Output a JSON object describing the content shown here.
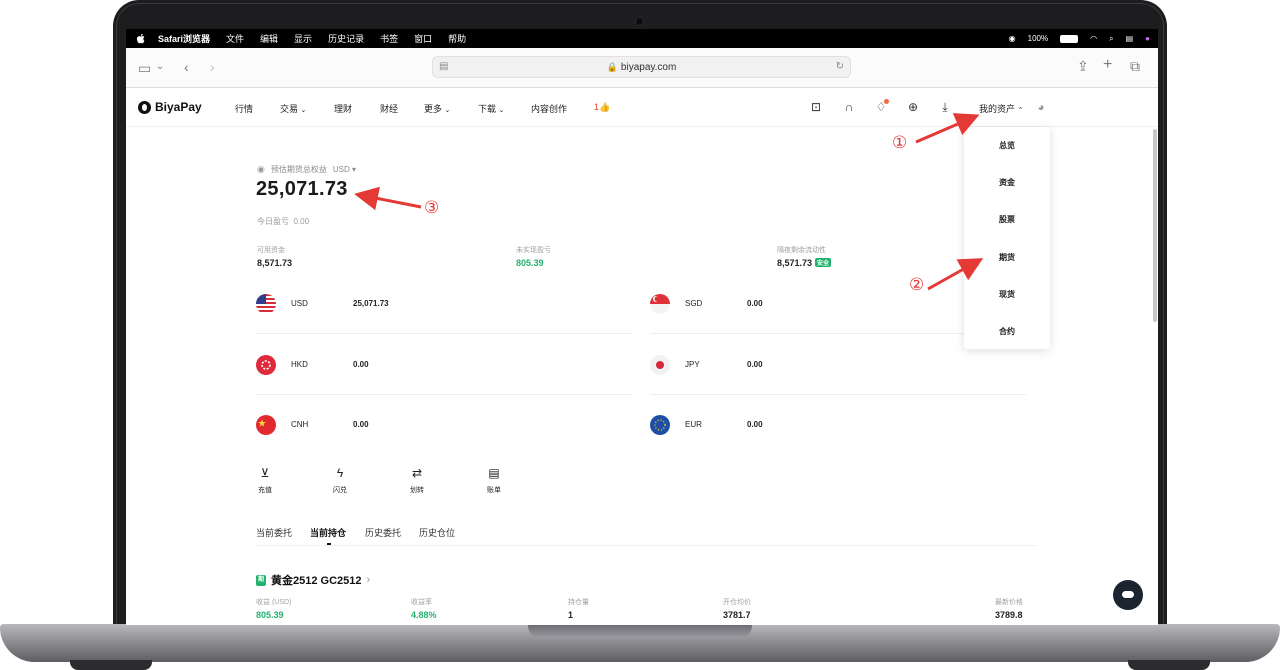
{
  "menubar": {
    "app_name": "Safari浏览器",
    "items": [
      "文件",
      "编辑",
      "显示",
      "历史记录",
      "书签",
      "窗口",
      "帮助"
    ],
    "battery": "100%"
  },
  "browser": {
    "url": "biyapay.com"
  },
  "site": {
    "logo": "BiyaPay",
    "nav": {
      "market": "行情",
      "trade": "交易",
      "wealth": "理财",
      "news": "财经",
      "more": "更多",
      "download": "下载",
      "create": "内容创作",
      "promo": "1👍"
    },
    "my_assets": "我的资产"
  },
  "equity": {
    "label": "预估期货总权益",
    "currency": "USD",
    "value": "25,071.73",
    "today_pl_label": "今日盈亏",
    "today_pl_value": "0.00"
  },
  "stats": {
    "available_label": "可用资金",
    "available_value": "8,571.73",
    "unrealized_label": "未实现盈亏",
    "unrealized_value": "805.39",
    "liquidity_label": "隔夜剩余流动性",
    "liquidity_value": "8,571.73",
    "safe_badge": "安全"
  },
  "currencies": [
    {
      "code": "USD",
      "value": "25,071.73"
    },
    {
      "code": "SGD",
      "value": "0.00"
    },
    {
      "code": "HKD",
      "value": "0.00"
    },
    {
      "code": "JPY",
      "value": "0.00"
    },
    {
      "code": "CNH",
      "value": "0.00"
    },
    {
      "code": "EUR",
      "value": "0.00"
    }
  ],
  "actions": [
    "充值",
    "闪兑",
    "划转",
    "账单"
  ],
  "tabs": [
    "当前委托",
    "当前持仓",
    "历史委托",
    "历史仓位"
  ],
  "position": {
    "badge": "期",
    "title": "黄金2512 GC2512",
    "cols": [
      {
        "label": "收益 (USD)",
        "value": "805.39"
      },
      {
        "label": "收益率",
        "value": "4.88%"
      },
      {
        "label": "持仓量",
        "value": "1"
      },
      {
        "label": "开仓均价",
        "value": "3781.7"
      },
      {
        "label": "最新价格",
        "value": "3789.8"
      }
    ]
  },
  "dropdown": [
    "总览",
    "资金",
    "股票",
    "期货",
    "现货",
    "合约"
  ],
  "annotations": [
    "①",
    "②",
    "③"
  ],
  "colors": {
    "accent_green": "#22b26e",
    "annotation_red": "#e53935"
  }
}
